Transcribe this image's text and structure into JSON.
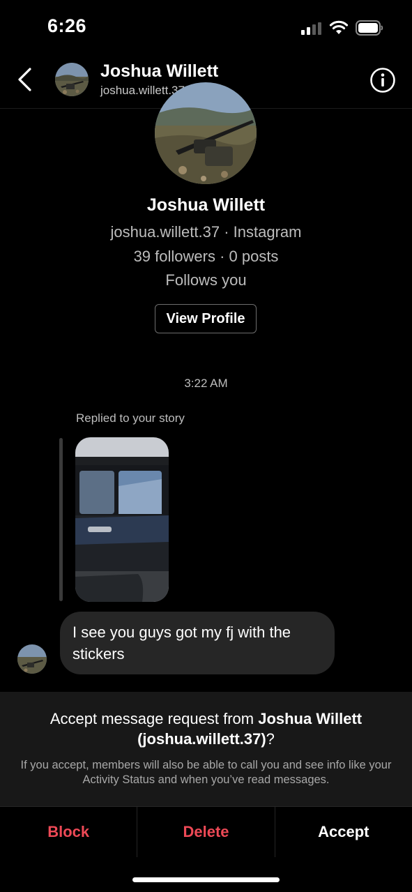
{
  "status_bar": {
    "time": "6:26"
  },
  "header": {
    "name": "Joshua Willett",
    "username": "joshua.willett.37"
  },
  "profile_card": {
    "name": "Joshua Willett",
    "user_line": "joshua.willett.37 · Instagram",
    "stats": "39 followers · 0 posts",
    "follows": "Follows you",
    "view_profile": "View Profile"
  },
  "conversation": {
    "timestamp": "3:22 AM",
    "reply_label": "Replied to your story",
    "message": "I see you guys got my fj with the stickers"
  },
  "request": {
    "title_prefix": "Accept message request from ",
    "title_name": "Joshua Willett",
    "title_username": "(joshua.willett.37)",
    "title_suffix": "?",
    "subtitle": "If you accept, members will also be able to call you and see info like your Activity Status and when you’ve read messages."
  },
  "actions": {
    "block": "Block",
    "delete": "Delete",
    "accept": "Accept"
  },
  "colors": {
    "background": "#000000",
    "danger": "#ed4956",
    "bubble": "#262626",
    "panel": "#181818"
  }
}
